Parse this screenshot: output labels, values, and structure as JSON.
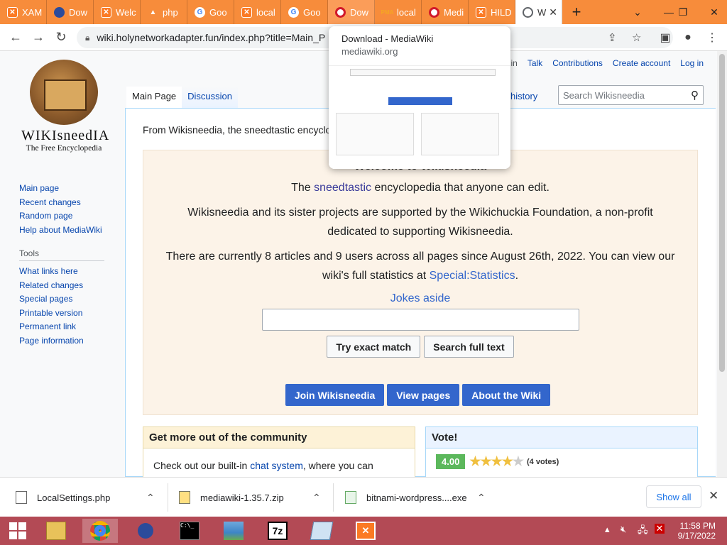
{
  "browser": {
    "tabs": [
      {
        "label": "XAM",
        "icon": "xampp"
      },
      {
        "label": "Dow",
        "icon": "shield"
      },
      {
        "label": "Welc",
        "icon": "xampp"
      },
      {
        "label": "php",
        "icon": "flame"
      },
      {
        "label": "Goo",
        "icon": "google"
      },
      {
        "label": "local",
        "icon": "xampp"
      },
      {
        "label": "Goo",
        "icon": "google"
      },
      {
        "label": "Dow",
        "icon": "opera"
      },
      {
        "label": "local",
        "icon": "pma"
      },
      {
        "label": "Medi",
        "icon": "opera"
      },
      {
        "label": "HILD",
        "icon": "xampp"
      },
      {
        "label": "W",
        "icon": "globe"
      }
    ],
    "url": "wiki.holynetworkadapter.fun/index.php?title=Main_P",
    "hovercard": {
      "title": "Download - MediaWiki",
      "domain": "mediawiki.org"
    }
  },
  "wiki": {
    "logo_title": "WIKIsneedIA",
    "logo_subtitle": "The Free Encyclopedia",
    "personal": {
      "not_logged": "ged in",
      "talk": "Talk",
      "contributions": "Contributions",
      "create": "Create account",
      "login": "Log in"
    },
    "tabs": {
      "main": "Main Page",
      "discussion": "Discussion",
      "history": "w history"
    },
    "search_placeholder": "Search Wikisneedia",
    "nav": [
      "Main page",
      "Recent changes",
      "Random page",
      "Help about MediaWiki"
    ],
    "tools_heading": "Tools",
    "tools": [
      "What links here",
      "Related changes",
      "Special pages",
      "Printable version",
      "Permanent link",
      "Page information"
    ],
    "intro": "From Wikisneedia, the sneedtastic encyclo",
    "welcome": {
      "title": "Welcome to Wikisneedia",
      "line1_pre": "The ",
      "line1_link": "sneedtastic",
      "line1_post": " encyclopedia that anyone can edit.",
      "line2": "Wikisneedia and its sister projects are supported by the Wikichuckia Foundation, a non-profit dedicated to supporting Wikisneedia.",
      "line3_pre": "There are currently 8 articles and 9 users across all pages since August 26th, 2022. You can view our wiki's full statistics at ",
      "line3_link": "Special:Statistics",
      "line3_post": ".",
      "jokes": "Jokes aside",
      "btn_exact": "Try exact match",
      "btn_full": "Search full text",
      "btn_join": "Join Wikisneedia",
      "btn_view": "View pages",
      "btn_about": "About the Wiki"
    },
    "community": {
      "heading": "Get more out of the community",
      "text_pre": "Check out our built-in ",
      "text_link": "chat system",
      "text_post": ", where you can"
    },
    "vote": {
      "heading": "Vote!",
      "score": "4.00",
      "stars": 4,
      "count": "(4 votes)"
    }
  },
  "downloads": {
    "items": [
      "LocalSettings.php",
      "mediawiki-1.35.7.zip",
      "bitnami-wordpress....exe"
    ],
    "show_all": "Show all"
  },
  "taskbar": {
    "time": "11:58 PM",
    "date": "9/17/2022"
  },
  "colors": {
    "tabstrip": "#f78c3b",
    "taskbar": "#b34a55",
    "accent": "#3366cc",
    "link": "#0645ad"
  }
}
